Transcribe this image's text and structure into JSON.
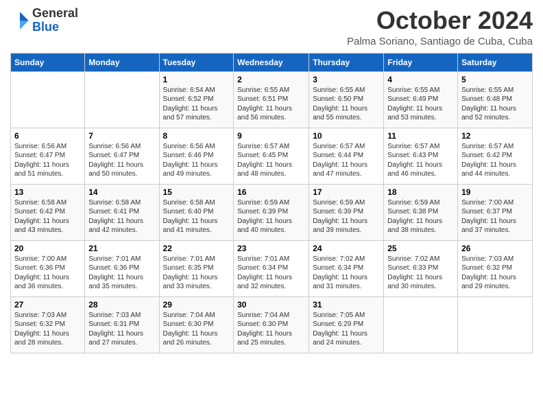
{
  "logo": {
    "general": "General",
    "blue": "Blue"
  },
  "title": "October 2024",
  "subtitle": "Palma Soriano, Santiago de Cuba, Cuba",
  "days_of_week": [
    "Sunday",
    "Monday",
    "Tuesday",
    "Wednesday",
    "Thursday",
    "Friday",
    "Saturday"
  ],
  "weeks": [
    [
      {
        "day": "",
        "detail": ""
      },
      {
        "day": "",
        "detail": ""
      },
      {
        "day": "1",
        "detail": "Sunrise: 6:54 AM\nSunset: 6:52 PM\nDaylight: 11 hours and 57 minutes."
      },
      {
        "day": "2",
        "detail": "Sunrise: 6:55 AM\nSunset: 6:51 PM\nDaylight: 11 hours and 56 minutes."
      },
      {
        "day": "3",
        "detail": "Sunrise: 6:55 AM\nSunset: 6:50 PM\nDaylight: 11 hours and 55 minutes."
      },
      {
        "day": "4",
        "detail": "Sunrise: 6:55 AM\nSunset: 6:49 PM\nDaylight: 11 hours and 53 minutes."
      },
      {
        "day": "5",
        "detail": "Sunrise: 6:55 AM\nSunset: 6:48 PM\nDaylight: 11 hours and 52 minutes."
      }
    ],
    [
      {
        "day": "6",
        "detail": "Sunrise: 6:56 AM\nSunset: 6:47 PM\nDaylight: 11 hours and 51 minutes."
      },
      {
        "day": "7",
        "detail": "Sunrise: 6:56 AM\nSunset: 6:47 PM\nDaylight: 11 hours and 50 minutes."
      },
      {
        "day": "8",
        "detail": "Sunrise: 6:56 AM\nSunset: 6:46 PM\nDaylight: 11 hours and 49 minutes."
      },
      {
        "day": "9",
        "detail": "Sunrise: 6:57 AM\nSunset: 6:45 PM\nDaylight: 11 hours and 48 minutes."
      },
      {
        "day": "10",
        "detail": "Sunrise: 6:57 AM\nSunset: 6:44 PM\nDaylight: 11 hours and 47 minutes."
      },
      {
        "day": "11",
        "detail": "Sunrise: 6:57 AM\nSunset: 6:43 PM\nDaylight: 11 hours and 46 minutes."
      },
      {
        "day": "12",
        "detail": "Sunrise: 6:57 AM\nSunset: 6:42 PM\nDaylight: 11 hours and 44 minutes."
      }
    ],
    [
      {
        "day": "13",
        "detail": "Sunrise: 6:58 AM\nSunset: 6:42 PM\nDaylight: 11 hours and 43 minutes."
      },
      {
        "day": "14",
        "detail": "Sunrise: 6:58 AM\nSunset: 6:41 PM\nDaylight: 11 hours and 42 minutes."
      },
      {
        "day": "15",
        "detail": "Sunrise: 6:58 AM\nSunset: 6:40 PM\nDaylight: 11 hours and 41 minutes."
      },
      {
        "day": "16",
        "detail": "Sunrise: 6:59 AM\nSunset: 6:39 PM\nDaylight: 11 hours and 40 minutes."
      },
      {
        "day": "17",
        "detail": "Sunrise: 6:59 AM\nSunset: 6:39 PM\nDaylight: 11 hours and 39 minutes."
      },
      {
        "day": "18",
        "detail": "Sunrise: 6:59 AM\nSunset: 6:38 PM\nDaylight: 11 hours and 38 minutes."
      },
      {
        "day": "19",
        "detail": "Sunrise: 7:00 AM\nSunset: 6:37 PM\nDaylight: 11 hours and 37 minutes."
      }
    ],
    [
      {
        "day": "20",
        "detail": "Sunrise: 7:00 AM\nSunset: 6:36 PM\nDaylight: 11 hours and 36 minutes."
      },
      {
        "day": "21",
        "detail": "Sunrise: 7:01 AM\nSunset: 6:36 PM\nDaylight: 11 hours and 35 minutes."
      },
      {
        "day": "22",
        "detail": "Sunrise: 7:01 AM\nSunset: 6:35 PM\nDaylight: 11 hours and 33 minutes."
      },
      {
        "day": "23",
        "detail": "Sunrise: 7:01 AM\nSunset: 6:34 PM\nDaylight: 11 hours and 32 minutes."
      },
      {
        "day": "24",
        "detail": "Sunrise: 7:02 AM\nSunset: 6:34 PM\nDaylight: 11 hours and 31 minutes."
      },
      {
        "day": "25",
        "detail": "Sunrise: 7:02 AM\nSunset: 6:33 PM\nDaylight: 11 hours and 30 minutes."
      },
      {
        "day": "26",
        "detail": "Sunrise: 7:03 AM\nSunset: 6:32 PM\nDaylight: 11 hours and 29 minutes."
      }
    ],
    [
      {
        "day": "27",
        "detail": "Sunrise: 7:03 AM\nSunset: 6:32 PM\nDaylight: 11 hours and 28 minutes."
      },
      {
        "day": "28",
        "detail": "Sunrise: 7:03 AM\nSunset: 6:31 PM\nDaylight: 11 hours and 27 minutes."
      },
      {
        "day": "29",
        "detail": "Sunrise: 7:04 AM\nSunset: 6:30 PM\nDaylight: 11 hours and 26 minutes."
      },
      {
        "day": "30",
        "detail": "Sunrise: 7:04 AM\nSunset: 6:30 PM\nDaylight: 11 hours and 25 minutes."
      },
      {
        "day": "31",
        "detail": "Sunrise: 7:05 AM\nSunset: 6:29 PM\nDaylight: 11 hours and 24 minutes."
      },
      {
        "day": "",
        "detail": ""
      },
      {
        "day": "",
        "detail": ""
      }
    ]
  ]
}
